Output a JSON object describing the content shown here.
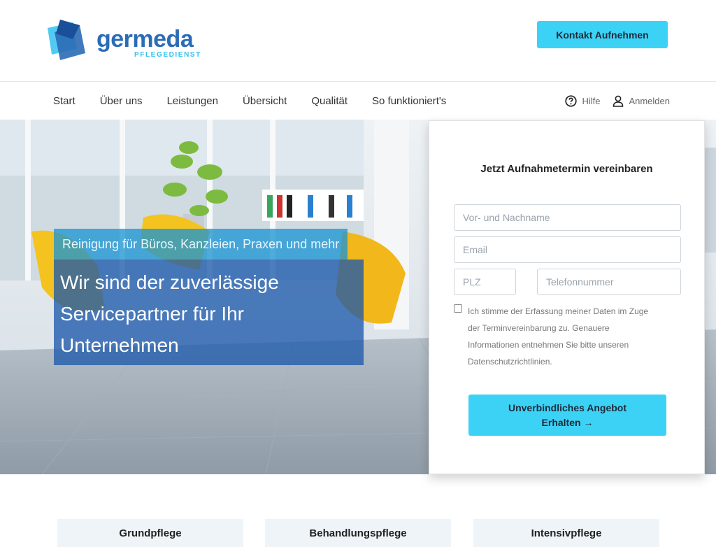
{
  "header": {
    "logo": {
      "name": "germeda",
      "subtitle": "PFLEGEDIENST"
    },
    "contact_button": "Kontakt Aufnehmen"
  },
  "nav": {
    "items": [
      {
        "label": "Start"
      },
      {
        "label": "Über uns"
      },
      {
        "label": "Leistungen"
      },
      {
        "label": "Übersicht"
      },
      {
        "label": "Qualität"
      },
      {
        "label": "So funktioniert's"
      }
    ],
    "help": {
      "label": "Hilfe",
      "icon": "question-circle-icon"
    },
    "login": {
      "label": "Anmelden",
      "icon": "user-icon"
    }
  },
  "hero": {
    "tagline": "Reinigung für Büros, Kanzleien, Praxen und mehr",
    "headline": [
      "Wir sind der zuverlässige",
      "Servicepartner für Ihr",
      "Unternehmen"
    ]
  },
  "form": {
    "title": "Jetzt Aufnahmetermin vereinbaren",
    "name_placeholder": "Vor- und Nachname",
    "email_placeholder": "Email",
    "plz_placeholder": "PLZ",
    "phone_placeholder": "Telefonnummer",
    "consent_lines": [
      "Ich stimme der Erfassung meiner Daten im Zuge",
      "der Terminvereinbarung zu. Genauere",
      "Informationen entnehmen Sie bitte unseren",
      "Datenschutzrichtlinien."
    ],
    "consent_checked": false,
    "submit_line1": "Unverbindliches Angebot",
    "submit_line2": "Erhalten →"
  },
  "services": [
    {
      "label": "Grundpflege"
    },
    {
      "label": "Behandlungspflege"
    },
    {
      "label": "Intensivpflege"
    }
  ],
  "colors": {
    "brand_blue": "#2b6cb6",
    "accent_cyan": "#3cd2f5",
    "hero_tag_bg": "#1e96d2",
    "hero_title_bg": "#1e5aaa"
  }
}
